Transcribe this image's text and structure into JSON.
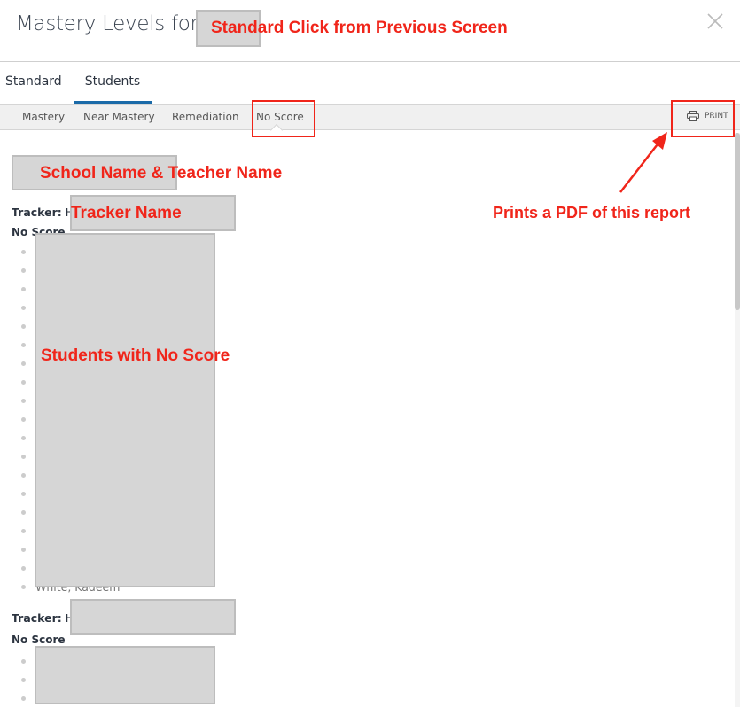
{
  "header": {
    "title": "Mastery Levels for 8",
    "close_icon": "close-icon"
  },
  "tabs": [
    {
      "label": "Standard",
      "active": false
    },
    {
      "label": "Students",
      "active": true
    }
  ],
  "filters": [
    {
      "label": "Mastery"
    },
    {
      "label": "Near Mastery"
    },
    {
      "label": "Remediation"
    },
    {
      "label": "No Score",
      "active": true
    }
  ],
  "print": {
    "label": "PRINT",
    "icon": "printer-icon"
  },
  "report": {
    "sections": [
      {
        "tracker_label": "Tracker:",
        "tracker_value": "H",
        "level": "No Score",
        "last_student": "White, Kadeem"
      },
      {
        "tracker_label": "Tracker:",
        "tracker_value": "H",
        "level": "No Score"
      }
    ]
  },
  "annotations": {
    "standard": "Standard Click from Previous Screen",
    "school": "School Name & Teacher Name",
    "tracker": "Tracker Name",
    "print": "Prints a PDF of this report",
    "students": "Students with No Score"
  },
  "colors": {
    "accent": "#1a6aa8",
    "annotation": "#f0251a",
    "redaction": "#d6d6d6"
  }
}
